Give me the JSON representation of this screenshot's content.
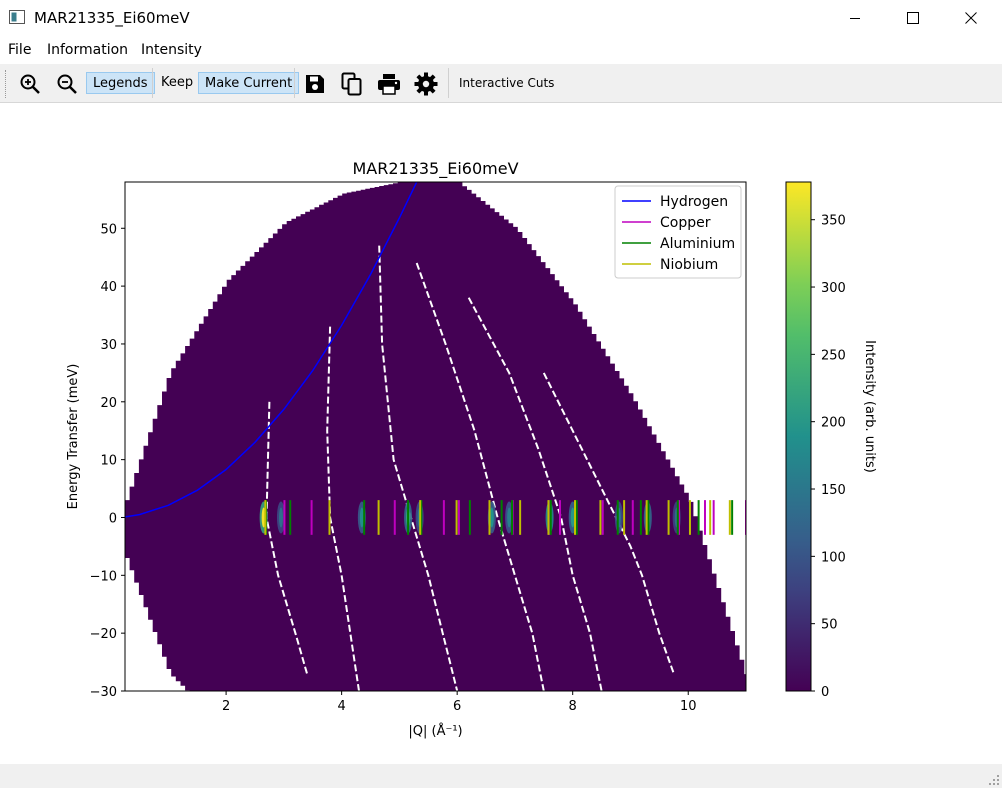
{
  "window": {
    "title": "MAR21335_Ei60meV",
    "minimize_icon": "minimize-icon",
    "maximize_icon": "maximize-icon",
    "close_icon": "close-icon"
  },
  "menu": {
    "items": [
      "File",
      "Information",
      "Intensity"
    ]
  },
  "toolbar": {
    "zoom_in_icon": "zoom-in-icon",
    "zoom_out_icon": "zoom-out-icon",
    "legends_label": "Legends",
    "keep_label": "Keep",
    "make_current_label": "Make Current",
    "save_icon": "save-icon",
    "copy_icon": "copy-icon",
    "print_icon": "print-icon",
    "settings_icon": "gear-icon",
    "interactive_cuts_label": "Interactive Cuts"
  },
  "chart_data": {
    "type": "heatmap",
    "title": "MAR21335_Ei60meV",
    "xlabel": "|Q| (Å⁻¹)",
    "ylabel": "Energy Transfer (meV)",
    "colorbar_label": "Intensity (arb. units)",
    "xlim": [
      0.25,
      11.0
    ],
    "ylim": [
      -30,
      58
    ],
    "xticks": [
      2,
      4,
      6,
      8,
      10
    ],
    "yticks": [
      -30,
      -20,
      -10,
      0,
      10,
      20,
      30,
      40,
      50
    ],
    "colorbar_ticks": [
      0,
      50,
      100,
      150,
      200,
      250,
      300,
      350
    ],
    "colorbar_range": [
      0,
      378
    ],
    "colormap": "viridis",
    "background_color": "#440154",
    "coverage_upper": [
      {
        "q": 0.25,
        "e": 3
      },
      {
        "q": 1.0,
        "e": 25
      },
      {
        "q": 2.0,
        "e": 41
      },
      {
        "q": 3.0,
        "e": 51
      },
      {
        "q": 4.0,
        "e": 56
      },
      {
        "q": 5.0,
        "e": 58
      },
      {
        "q": 6.0,
        "e": 58
      },
      {
        "q": 7.0,
        "e": 50
      },
      {
        "q": 8.0,
        "e": 37
      },
      {
        "q": 9.0,
        "e": 21
      },
      {
        "q": 10.0,
        "e": 3
      },
      {
        "q": 11.0,
        "e": -28
      }
    ],
    "coverage_lower": [
      {
        "q": 0.25,
        "e": -7
      },
      {
        "q": 1.0,
        "e": -27
      },
      {
        "q": 1.3,
        "e": -30
      }
    ],
    "gap_curves": [
      [
        {
          "q": 2.75,
          "e": 20
        },
        {
          "q": 2.7,
          "e": 0
        },
        {
          "q": 2.9,
          "e": -10
        },
        {
          "q": 3.2,
          "e": -20
        },
        {
          "q": 3.4,
          "e": -27
        }
      ],
      [
        {
          "q": 3.8,
          "e": 33
        },
        {
          "q": 3.75,
          "e": 15
        },
        {
          "q": 3.8,
          "e": 0
        },
        {
          "q": 4.0,
          "e": -10
        },
        {
          "q": 4.3,
          "e": -30
        }
      ],
      [
        {
          "q": 4.65,
          "e": 47
        },
        {
          "q": 4.7,
          "e": 30
        },
        {
          "q": 4.9,
          "e": 10
        },
        {
          "q": 5.2,
          "e": 0
        },
        {
          "q": 5.5,
          "e": -10
        },
        {
          "q": 5.75,
          "e": -20
        },
        {
          "q": 6.0,
          "e": -30
        }
      ],
      [
        {
          "q": 5.3,
          "e": 44
        },
        {
          "q": 5.8,
          "e": 30
        },
        {
          "q": 6.3,
          "e": 15
        },
        {
          "q": 6.7,
          "e": 0
        },
        {
          "q": 7.0,
          "e": -10
        },
        {
          "q": 7.3,
          "e": -20
        },
        {
          "q": 7.5,
          "e": -30
        }
      ],
      [
        {
          "q": 6.2,
          "e": 38
        },
        {
          "q": 6.9,
          "e": 25
        },
        {
          "q": 7.4,
          "e": 12
        },
        {
          "q": 7.8,
          "e": 0
        },
        {
          "q": 8.0,
          "e": -10
        },
        {
          "q": 8.3,
          "e": -20
        },
        {
          "q": 8.5,
          "e": -30
        }
      ],
      [
        {
          "q": 7.5,
          "e": 25
        },
        {
          "q": 8.0,
          "e": 15
        },
        {
          "q": 8.5,
          "e": 5
        },
        {
          "q": 9.0,
          "e": -5
        },
        {
          "q": 9.2,
          "e": -10
        },
        {
          "q": 9.5,
          "e": -20
        },
        {
          "q": 9.75,
          "e": -27
        }
      ]
    ],
    "intensity_blobs": [
      {
        "q": 2.65,
        "e": 0,
        "intensity": 370
      },
      {
        "q": 2.95,
        "e": 0,
        "intensity": 140
      },
      {
        "q": 4.35,
        "e": 0,
        "intensity": 180
      },
      {
        "q": 5.15,
        "e": 0,
        "intensity": 220
      },
      {
        "q": 5.35,
        "e": 0,
        "intensity": 150
      },
      {
        "q": 6.6,
        "e": 0,
        "intensity": 190
      },
      {
        "q": 6.9,
        "e": 0,
        "intensity": 160
      },
      {
        "q": 7.6,
        "e": 0,
        "intensity": 300
      },
      {
        "q": 8.0,
        "e": 0,
        "intensity": 200
      },
      {
        "q": 8.8,
        "e": 0,
        "intensity": 150
      },
      {
        "q": 9.3,
        "e": 0,
        "intensity": 210
      },
      {
        "q": 9.8,
        "e": 0,
        "intensity": 130
      }
    ],
    "series": [
      {
        "name": "Hydrogen",
        "color": "#0000ff",
        "kind": "recoil_line",
        "points": [
          {
            "q": 0.25,
            "e": 0.1
          },
          {
            "q": 0.5,
            "e": 0.5
          },
          {
            "q": 1.0,
            "e": 2.1
          },
          {
            "q": 1.5,
            "e": 4.7
          },
          {
            "q": 2.0,
            "e": 8.3
          },
          {
            "q": 2.5,
            "e": 13.0
          },
          {
            "q": 3.0,
            "e": 18.7
          },
          {
            "q": 3.5,
            "e": 25.4
          },
          {
            "q": 4.0,
            "e": 33.2
          },
          {
            "q": 4.5,
            "e": 42.0
          },
          {
            "q": 5.0,
            "e": 51.8
          },
          {
            "q": 5.3,
            "e": 58.0
          }
        ]
      },
      {
        "name": "Copper",
        "color": "#bf00bf",
        "kind": "bragg_ticks",
        "q_values": [
          3.01,
          3.48,
          4.92,
          5.77,
          6.03,
          6.96,
          7.59,
          7.78,
          8.52,
          9.04,
          9.84,
          10.29,
          10.44,
          11.0
        ]
      },
      {
        "name": "Aluminium",
        "color": "#008000",
        "kind": "bragg_ticks",
        "q_values": [
          2.69,
          3.11,
          4.39,
          5.15,
          5.38,
          6.22,
          6.77,
          6.95,
          7.62,
          8.07,
          8.78,
          9.18,
          9.31,
          9.82,
          10.18,
          10.76
        ]
      },
      {
        "name": "Niobium",
        "color": "#bfbf00",
        "kind": "bragg_ticks",
        "q_values": [
          2.68,
          3.79,
          4.64,
          5.36,
          5.99,
          6.56,
          7.09,
          7.58,
          8.04,
          8.48,
          8.89,
          9.28,
          9.66,
          10.03,
          10.38,
          10.72
        ]
      }
    ],
    "legend_position": "top-right",
    "grid": false
  }
}
